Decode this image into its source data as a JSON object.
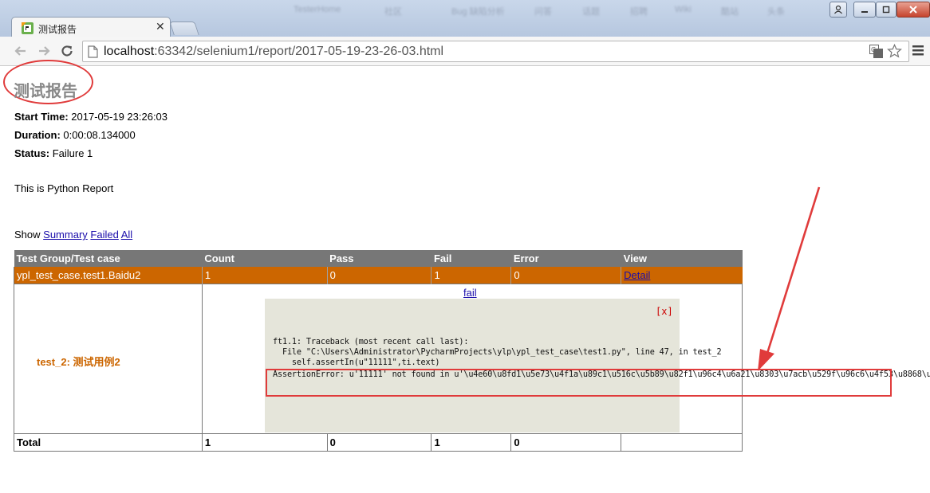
{
  "browser": {
    "tab_title": "测试报告",
    "blurred_bookmarks": [
      "TesterHome",
      "社区",
      "Bug 缺陷分析",
      "问答",
      "话题",
      "招聘",
      "Wiki",
      "酷站",
      "头条"
    ],
    "url_host": "localhost",
    "url_path": ":63342/selenium1/report/2017-05-19-23-26-03.html"
  },
  "report": {
    "title": "测试报告",
    "start_time_label": "Start Time:",
    "start_time": "2017-05-19 23:26:03",
    "duration_label": "Duration:",
    "duration": "0:00:08.134000",
    "status_label": "Status:",
    "status": "Failure 1",
    "description": "This is Python Report"
  },
  "show_bar": {
    "label": "Show",
    "summary": "Summary",
    "failed": "Failed",
    "all": "All"
  },
  "table": {
    "headers": [
      "Test Group/Test case",
      "Count",
      "Pass",
      "Fail",
      "Error",
      "View"
    ],
    "class_row": {
      "name": "ypl_test_case.test1.Baidu2",
      "count": "1",
      "pass": "0",
      "fail": "1",
      "error": "0",
      "view": "Detail"
    },
    "test_row": {
      "name": "test_2: 测试用例2",
      "fail_link": "fail",
      "close": "[x]",
      "trace": [
        "ft1.1: Traceback (most recent call last):",
        "  File \"C:\\Users\\Administrator\\PycharmProjects\\ylp\\ypl_test_case\\test1.py\", line 47, in test_2",
        "    self.assertIn(u\"11111\",ti.text)",
        "AssertionError: u'11111' not found in u'\\u4e60\\u8fd1\\u5e73\\u4f1a\\u89c1\\u516c\\u5b89\\u82f1\\u96c4\\u6a21\\u8303\\u7acb\\u529f\\u96c6\\u4f53\\u8868\\u"
      ]
    },
    "total_row": {
      "label": "Total",
      "count": "1",
      "pass": "0",
      "fail": "1",
      "error": "0"
    }
  },
  "colors": {
    "class_row_bg": "#cc6600",
    "header_bg": "#777777",
    "annotation_red": "#e03b3b",
    "popup_bg": "#e5e5da"
  }
}
